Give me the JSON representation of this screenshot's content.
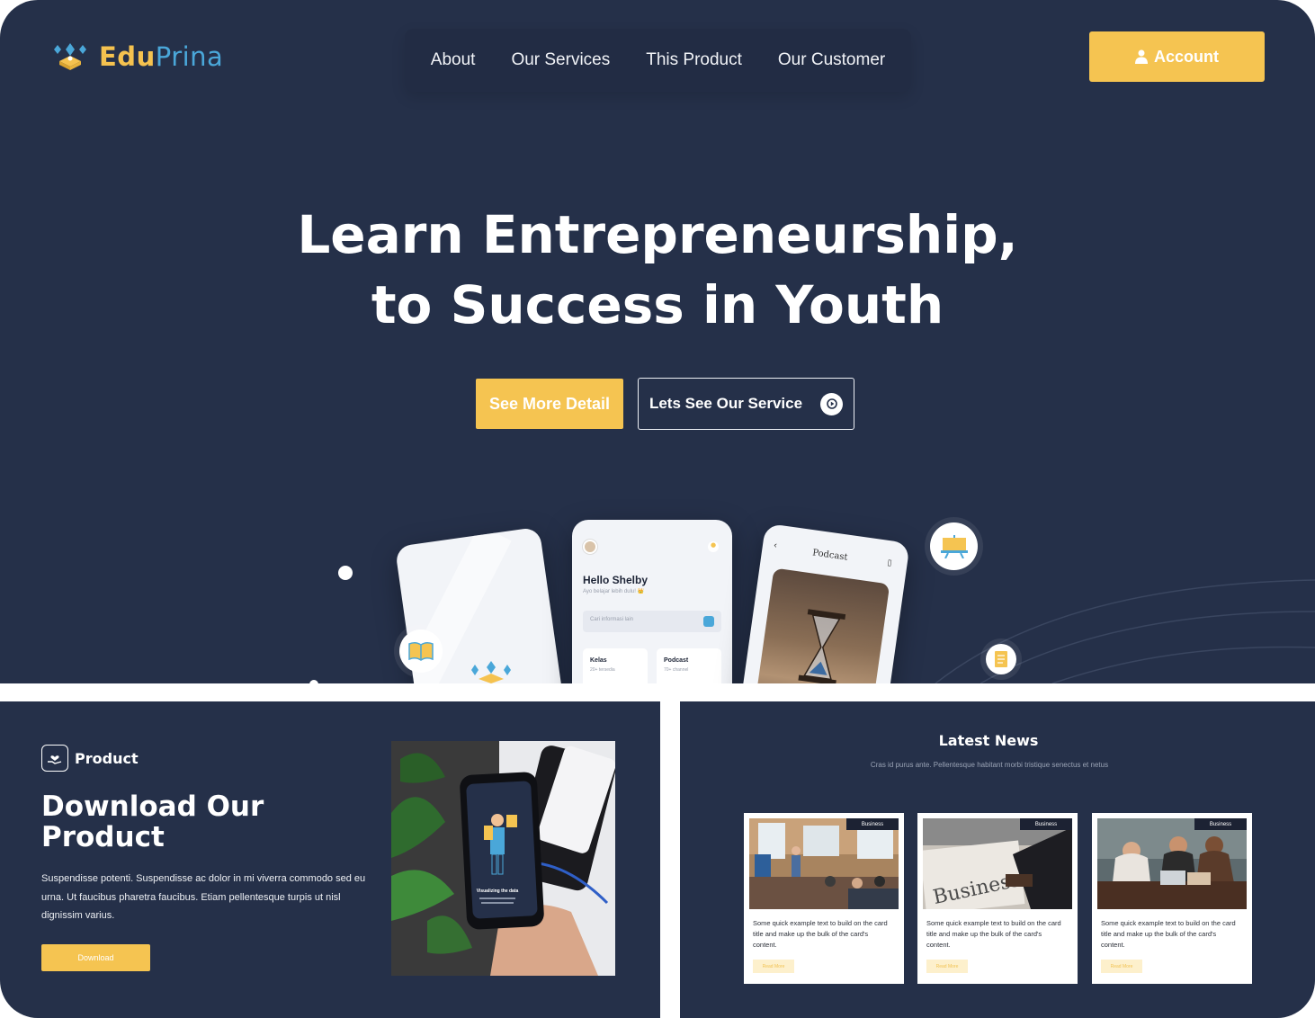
{
  "header": {
    "brand_part1": "Edu",
    "brand_part2": "Prina",
    "nav": [
      "About",
      "Our Services",
      "This Product",
      "Our Customer"
    ],
    "account_label": "Account"
  },
  "hero": {
    "title_line1": "Learn Entrepreneurship,",
    "title_line2": "to Success in Youth",
    "primary_button": "See More Detail",
    "secondary_button": "Lets See Our Service"
  },
  "mockup": {
    "greeting": "Hello Shelby",
    "greeting_sub": "Ayo belajar lebih dulu! 👑",
    "search_placeholder": "Cari informasi lain",
    "tile1_title": "Kelas",
    "tile1_sub": "20+ tersedia",
    "tile2_title": "Podcast",
    "tile2_sub": "70+ channel",
    "podcast_title": "Podcast"
  },
  "product": {
    "tag": "Product",
    "title": "Download Our Product",
    "text": "Suspendisse potenti. Suspendisse ac dolor in mi viverra commodo sed eu urna. Ut faucibus pharetra faucibus. Etiam pellentesque turpis ut nisl dignissim varius.",
    "button": "Download",
    "phone_caption": "Visualizing the data",
    "phone_caption_sub": "Here explore the wonders the world in entrepreneurship. You can see the data on market visualization in the most"
  },
  "news": {
    "title": "Latest News",
    "subtitle": "Cras id purus ante. Pellentesque habitant morbi tristique senectus et netus",
    "cards": [
      {
        "badge": "Business",
        "text": "Some quick example text to build on the card title and make up the bulk of the card's content.",
        "button": "Read More"
      },
      {
        "badge": "Business",
        "text": "Some quick example text to build on the card title and make up the bulk of the card's content.",
        "button": "Read More",
        "image_word": "Business"
      },
      {
        "badge": "Business",
        "text": "Some quick example text to build on the card title and make up the bulk of the card's content.",
        "button": "Read More"
      }
    ]
  },
  "colors": {
    "navy": "#253049",
    "accent_yellow": "#f5c451",
    "accent_blue": "#4aa7d9"
  }
}
